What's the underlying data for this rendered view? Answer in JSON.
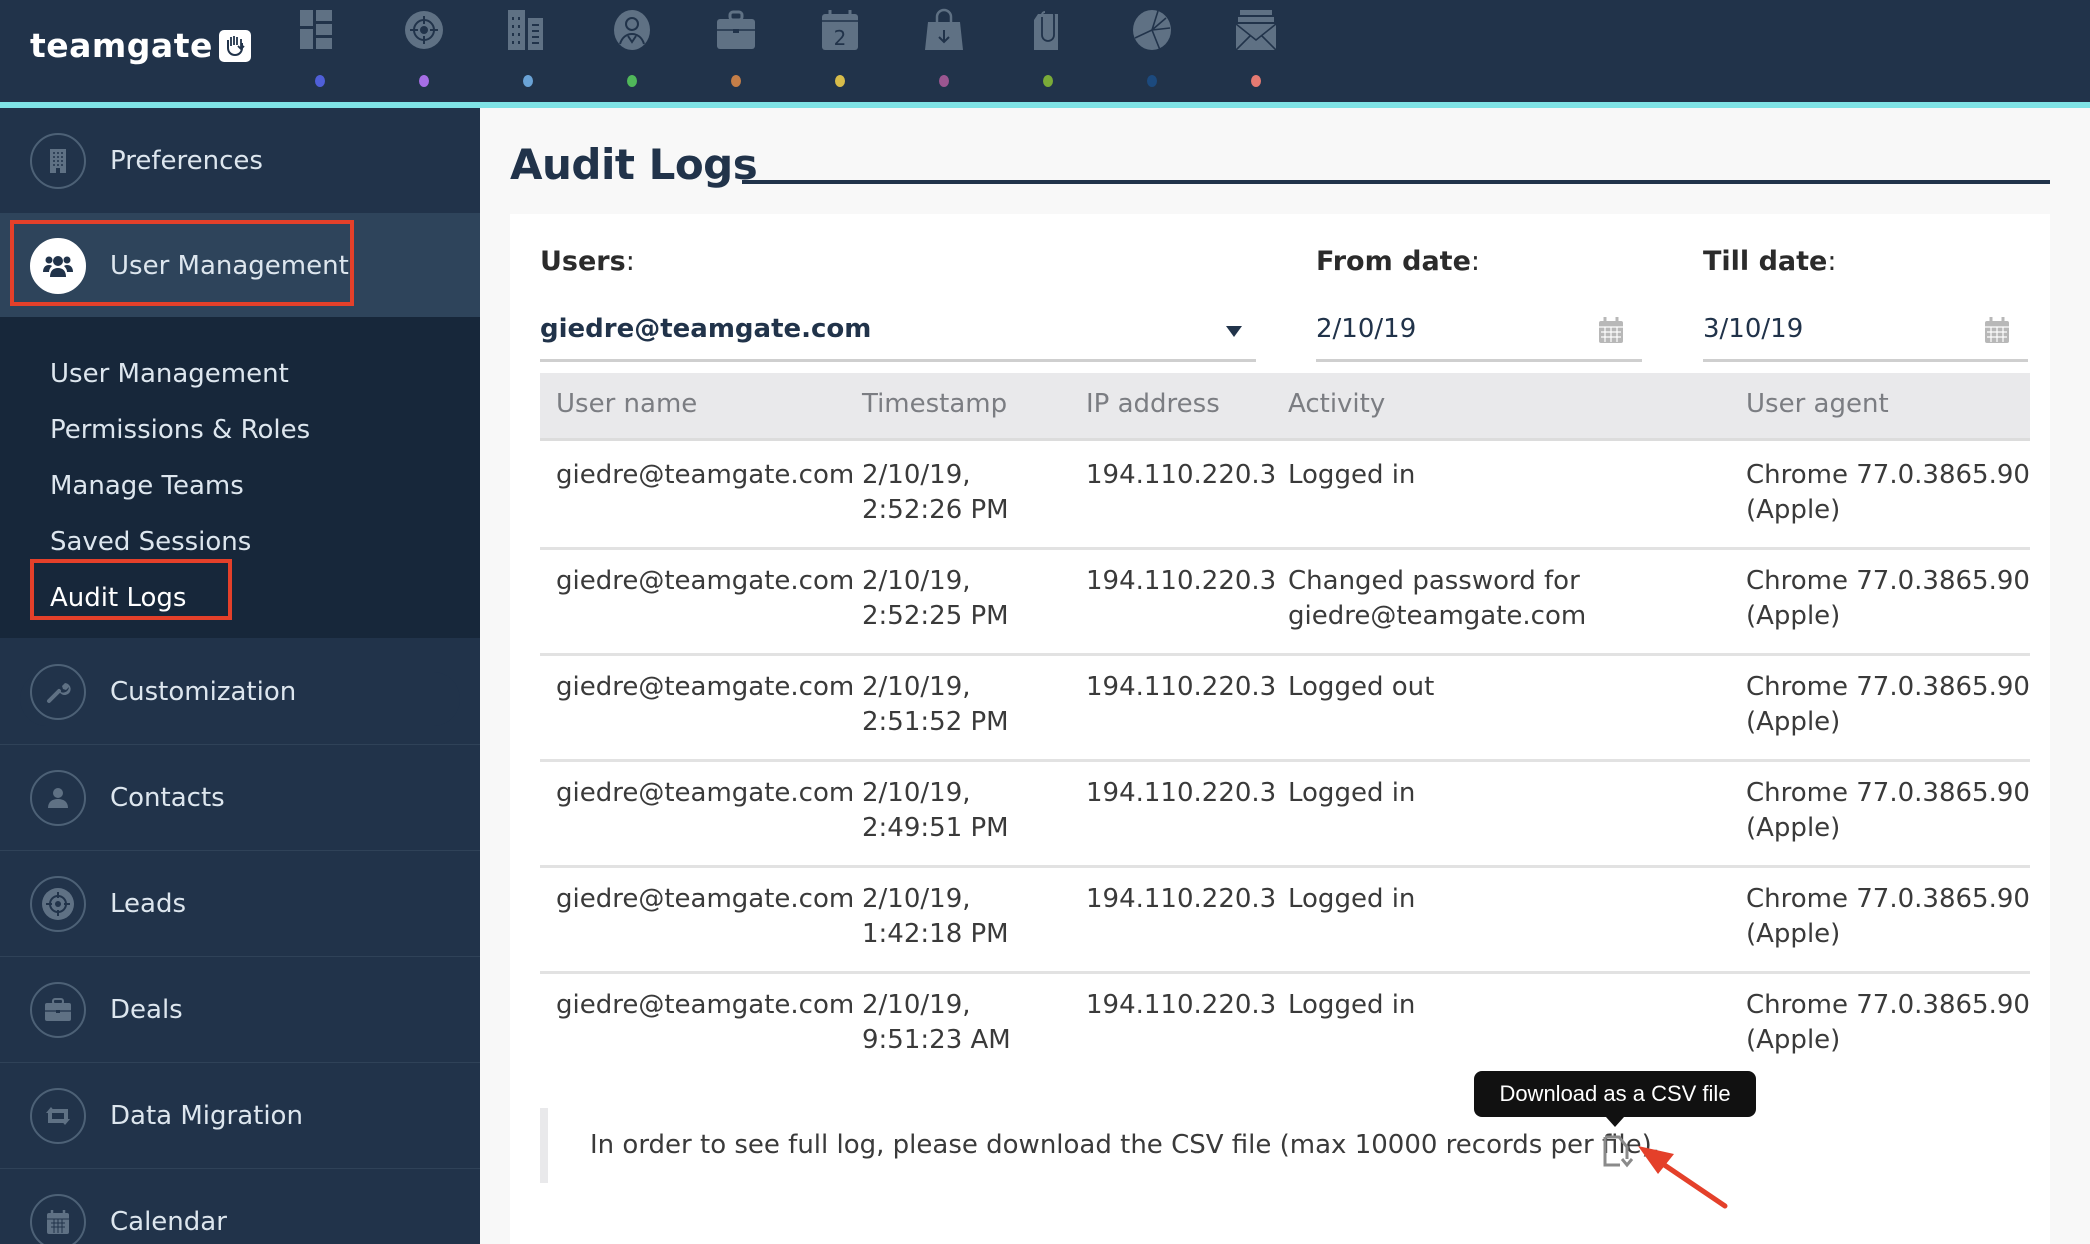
{
  "app": {
    "logo_text": "teamgate"
  },
  "topnav": {
    "items": [
      {
        "icon": "dashboard-icon",
        "dot_color": "#4f5fd8"
      },
      {
        "icon": "target-icon",
        "dot_color": "#a66ee6"
      },
      {
        "icon": "buildings-icon",
        "dot_color": "#6aa3d6"
      },
      {
        "icon": "contact-person-icon",
        "dot_color": "#50b85a"
      },
      {
        "icon": "briefcase-icon",
        "dot_color": "#c47e48"
      },
      {
        "icon": "calendar-icon",
        "dot_color": "#d7bc4a",
        "badge": "2"
      },
      {
        "icon": "shopping-bag-icon",
        "dot_color": "#9b5690"
      },
      {
        "icon": "paperclip-document-icon",
        "dot_color": "#7aab38"
      },
      {
        "icon": "pie-chart-icon",
        "dot_color": "#1c4a7e"
      },
      {
        "icon": "mail-icon",
        "dot_color": "#e57a72"
      }
    ]
  },
  "sidebar": {
    "items": [
      {
        "label": "Preferences",
        "icon": "building-icon"
      },
      {
        "label": "User Management",
        "icon": "users-group-icon",
        "active": true
      },
      {
        "label": "Customization",
        "icon": "wrench-icon"
      },
      {
        "label": "Contacts",
        "icon": "person-icon"
      },
      {
        "label": "Leads",
        "icon": "target-icon"
      },
      {
        "label": "Deals",
        "icon": "briefcase-icon"
      },
      {
        "label": "Data Migration",
        "icon": "sync-arrows-icon"
      },
      {
        "label": "Calendar",
        "icon": "calendar-icon"
      }
    ],
    "submenu": [
      {
        "label": "User Management"
      },
      {
        "label": "Permissions & Roles"
      },
      {
        "label": "Manage Teams"
      },
      {
        "label": "Saved Sessions"
      },
      {
        "label": "Audit Logs",
        "active": true
      }
    ]
  },
  "main": {
    "title": "Audit Logs",
    "filters": {
      "users_label": "Users",
      "users_value": "giedre@teamgate.com",
      "from_label": "From date",
      "from_value": "2/10/19",
      "till_label": "Till date",
      "till_value": "3/10/19",
      "colon": ":"
    },
    "table": {
      "columns": [
        "User name",
        "Timestamp",
        "IP address",
        "Activity",
        "User agent"
      ],
      "rows": [
        {
          "user": "giedre@teamgate.com",
          "ts_date": "2/10/19,",
          "ts_time": "2:52:26 PM",
          "ip": "194.110.220.3",
          "activity_1": "Logged in",
          "activity_2": "",
          "agent_1": "Chrome 77.0.3865.90",
          "agent_2": "(Apple)"
        },
        {
          "user": "giedre@teamgate.com",
          "ts_date": "2/10/19,",
          "ts_time": "2:52:25 PM",
          "ip": "194.110.220.3",
          "activity_1": "Changed password for",
          "activity_2": "giedre@teamgate.com",
          "agent_1": "Chrome 77.0.3865.90",
          "agent_2": "(Apple)"
        },
        {
          "user": "giedre@teamgate.com",
          "ts_date": "2/10/19,",
          "ts_time": "2:51:52 PM",
          "ip": "194.110.220.3",
          "activity_1": "Logged out",
          "activity_2": "",
          "agent_1": "Chrome 77.0.3865.90",
          "agent_2": "(Apple)"
        },
        {
          "user": "giedre@teamgate.com",
          "ts_date": "2/10/19,",
          "ts_time": "2:49:51 PM",
          "ip": "194.110.220.3",
          "activity_1": "Logged in",
          "activity_2": "",
          "agent_1": "Chrome 77.0.3865.90",
          "agent_2": "(Apple)"
        },
        {
          "user": "giedre@teamgate.com",
          "ts_date": "2/10/19,",
          "ts_time": "1:42:18 PM",
          "ip": "194.110.220.3",
          "activity_1": "Logged in",
          "activity_2": "",
          "agent_1": "Chrome 77.0.3865.90",
          "agent_2": "(Apple)"
        },
        {
          "user": "giedre@teamgate.com",
          "ts_date": "2/10/19,",
          "ts_time": "9:51:23 AM",
          "ip": "194.110.220.3",
          "activity_1": "Logged in",
          "activity_2": "",
          "agent_1": "Chrome 77.0.3865.90",
          "agent_2": "(Apple)"
        }
      ]
    },
    "note": "In order to see full log, please download the CSV file (max 10000 records per file).",
    "csv_tooltip": "Download as a CSV file"
  },
  "colors": {
    "topbar": "#21334a",
    "accent_line": "#7fe3e6",
    "annotation_red": "#e4402a"
  }
}
